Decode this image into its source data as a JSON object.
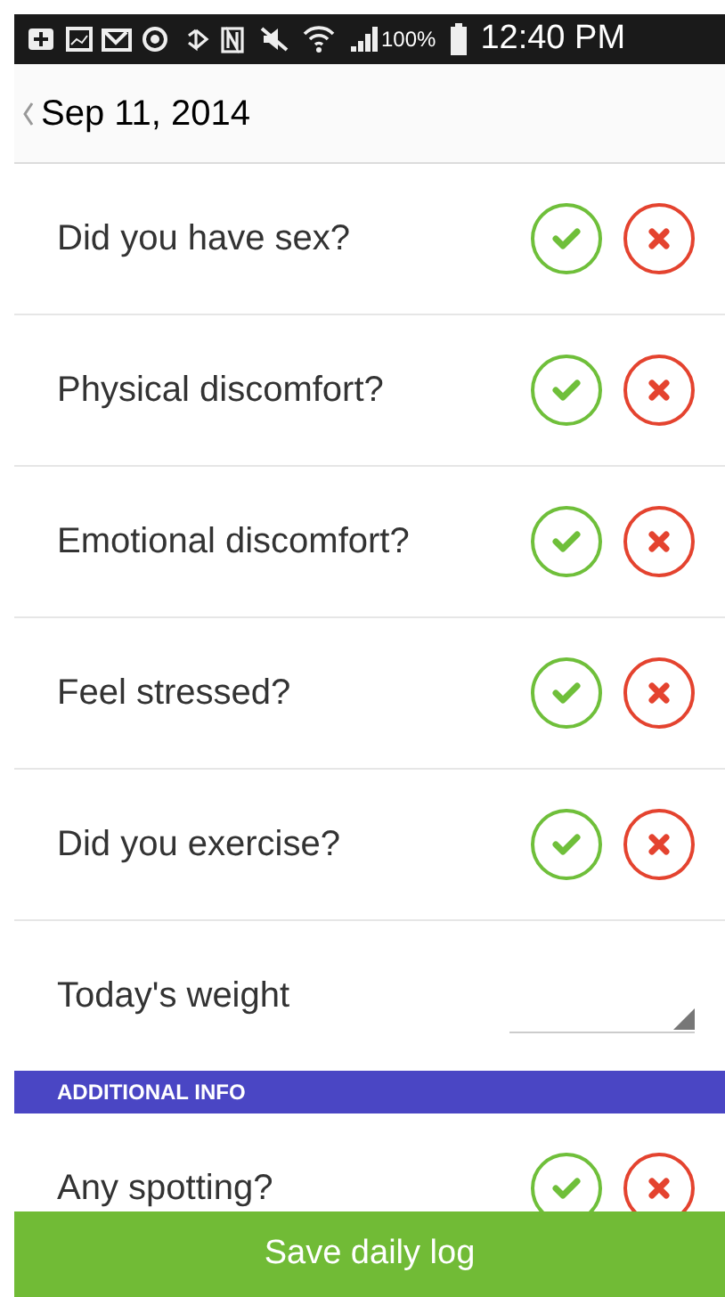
{
  "status_bar": {
    "battery": "100%",
    "time": "12:40 PM"
  },
  "header": {
    "date": "Sep 11, 2014"
  },
  "items": [
    {
      "kind": "yes_no",
      "label": "Did you have sex?"
    },
    {
      "kind": "yes_no",
      "label": "Physical discomfort?"
    },
    {
      "kind": "yes_no",
      "label": "Emotional discomfort?"
    },
    {
      "kind": "yes_no",
      "label": "Feel stressed?"
    },
    {
      "kind": "yes_no",
      "label": "Did you exercise?"
    },
    {
      "kind": "weight",
      "label": "Today's weight"
    },
    {
      "kind": "section",
      "label": "ADDITIONAL INFO"
    },
    {
      "kind": "yes_no",
      "label": "Any spotting?"
    }
  ],
  "save_button": "Save daily log"
}
